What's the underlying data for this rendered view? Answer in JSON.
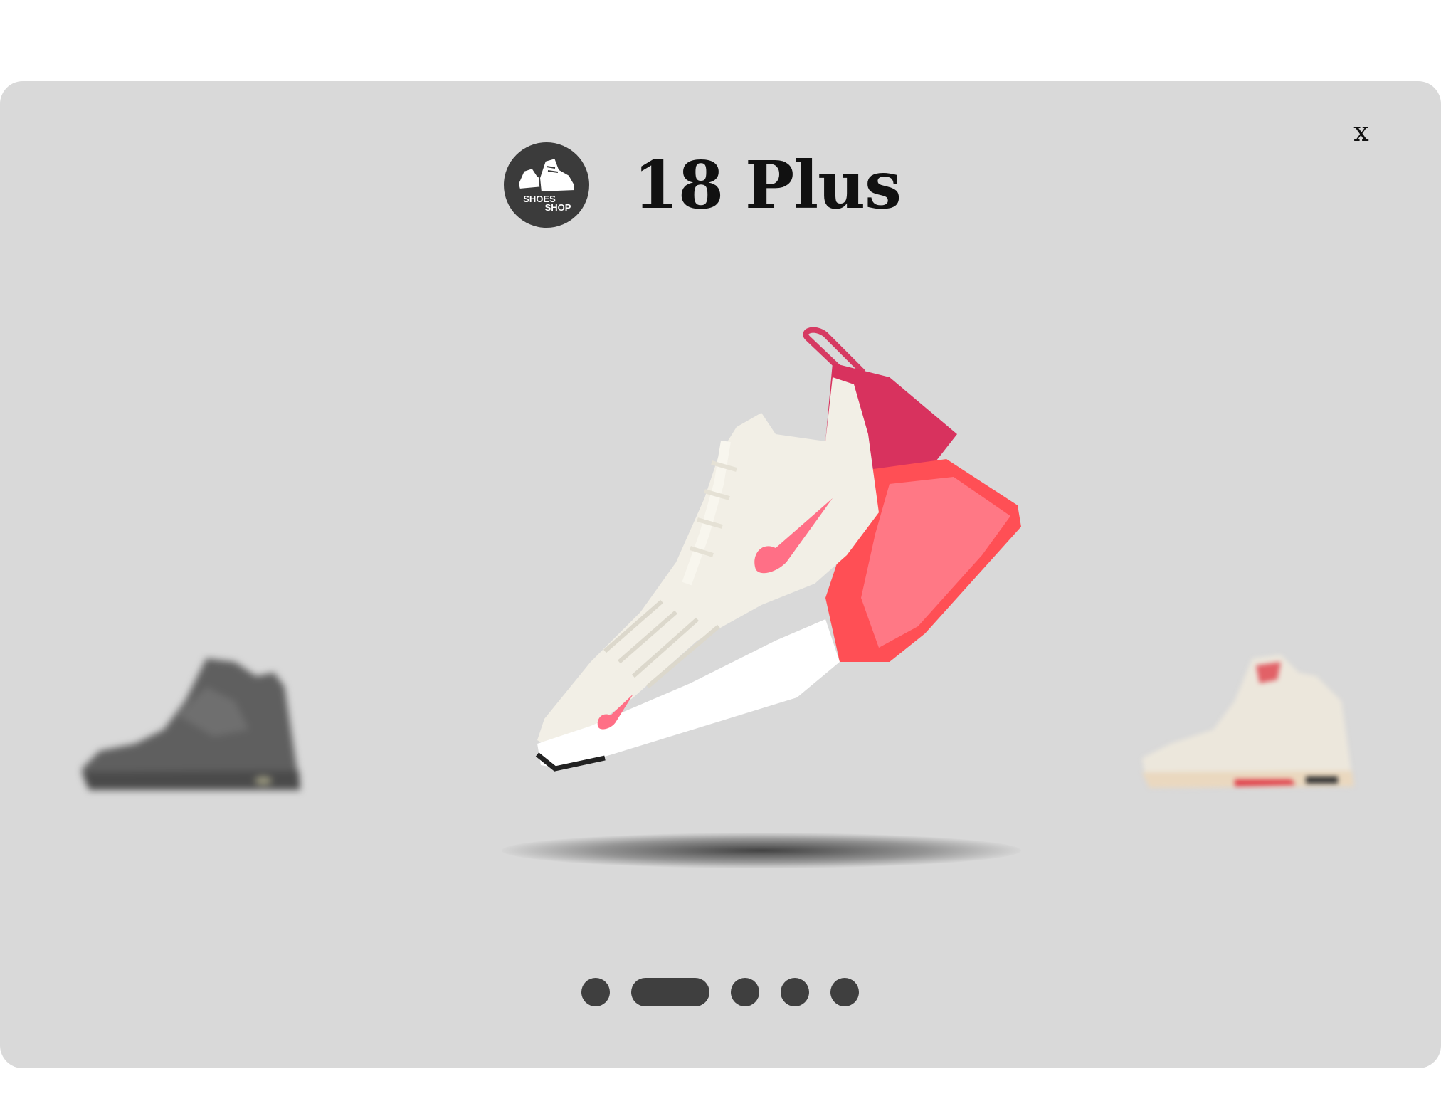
{
  "brand": {
    "name": "18 Plus",
    "logo_text_line1": "SHOES",
    "logo_text_line2": "SHOP"
  },
  "close_label": "x",
  "carousel": {
    "slides": [
      {
        "name": "grey-sneaker",
        "position": "previous"
      },
      {
        "name": "pink-air-max-270",
        "position": "current"
      },
      {
        "name": "cream-red-sneaker",
        "position": "next"
      }
    ],
    "pager": {
      "total": 5,
      "active_index": 1
    }
  },
  "colors": {
    "background": "#d9d9d9",
    "accent_pink": "#e8305a",
    "dot": "#3f3f3f",
    "logo_bg": "#3b3b3b"
  }
}
